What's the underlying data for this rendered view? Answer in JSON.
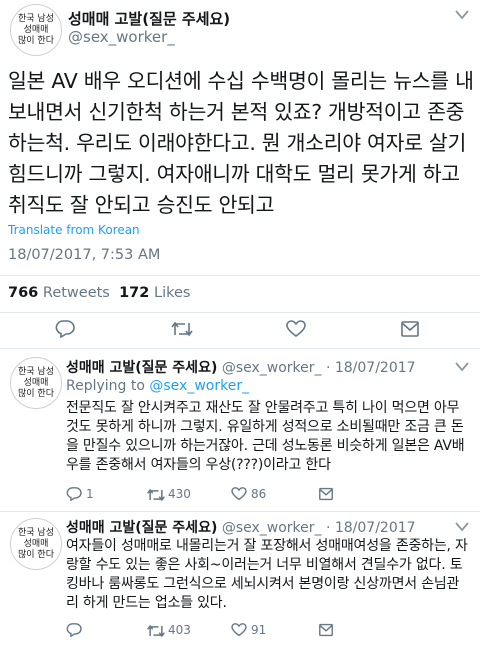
{
  "main_tweet": {
    "avatar_text": "한국 남성\n성매매\n많이 한다",
    "display_name": "성매매 고발(질문 주세요)",
    "handle": "@sex_worker_",
    "text": "일본 AV 배우 오디션에 수십 수백명이 몰리는 뉴스를 내보내면서 신기한척 하는거 본적 있죠? 개방적이고 존중하는척. 우리도 이래야한다고. 뭔 개소리야 여자로 살기 힘드니까 그렇지. 여자애니까 대학도 멀리 못가게 하고 취직도 잘 안되고 승진도 안되고",
    "translate_label": "Translate from Korean",
    "timestamp": "18/07/2017, 7:53 AM",
    "retweets_count": "766",
    "retweets_label": "Retweets",
    "likes_count": "172",
    "likes_label": "Likes"
  },
  "replies": [
    {
      "avatar_text": "한국 남성\n성매매\n많이 한다",
      "display_name": "성매매 고발(질문 주세요)",
      "handle_date": "@sex_worker_ · 18/07/2017",
      "replying_prefix": "Replying to",
      "replying_handle": "@sex_worker_",
      "text": "전문직도 잘 안시켜주고 재산도 잘 안물려주고 특히 나이 먹으면 아무것도 못하게 하니까 그렇지. 유일하게 성적으로 소비될때만 조금 큰 돈을 만질수 있으니까 하는거잖아. 근데 성노동론 비슷하게 일본은 AV배우를 존중해서 여자들의 우상(???)이라고 한다",
      "reply_count": "1",
      "retweet_count": "430",
      "like_count": "86"
    },
    {
      "avatar_text": "한국 남성\n성매매\n많이 한다",
      "display_name": "성매매 고발(질문 주세요)",
      "handle_date": "@sex_worker_ · 18/07/2017",
      "text": "여자들이 성매매로 내몰리는거 잘 포장해서 성매매여성을 존중하는, 자랑할 수도 있는 좋은 사회~이러는거 너무 비열해서 견딜수가 없다. 토킹바나 룸싸롱도 그런식으로 세뇌시켜서 본명이랑 신상까면서 손님관리 하게 만드는 업소들 있다.",
      "reply_count": "",
      "retweet_count": "403",
      "like_count": "91"
    }
  ],
  "colors": {
    "accent": "#1da1f2",
    "secondary_text": "#657786",
    "divider": "#e1e8ed",
    "retweet_green": "#17bf63"
  }
}
